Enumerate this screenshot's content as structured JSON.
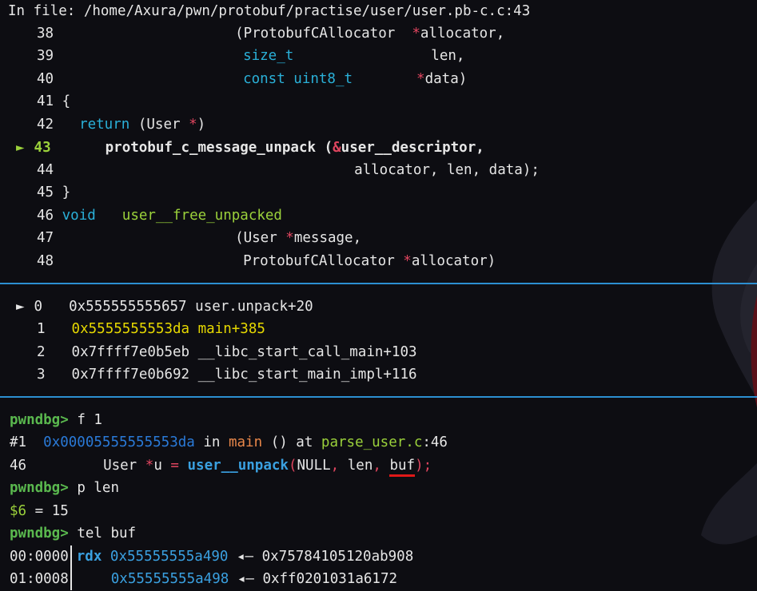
{
  "header": "In file: /home/Axura/pwn/protobuf/practise/user/user.pb-c.c:43",
  "source_lines": {
    "l38": {
      "num": "38",
      "a": "(ProtobufCAllocator  ",
      "star": "*",
      "b": "allocator,"
    },
    "l39": {
      "num": "39",
      "type": "size_t",
      "b": "len,"
    },
    "l40": {
      "num": "40",
      "type": "const uint8_t",
      "star": "*",
      "b": "data)"
    },
    "l41": {
      "num": "41",
      "b": "{"
    },
    "l42": {
      "num": "42",
      "kw": "return",
      "a": " (User ",
      "star": "*",
      "b": ")"
    },
    "l43": {
      "marker": "►",
      "num": "43",
      "fn": "protobuf_c_message_unpack",
      "a": " (",
      "amp": "&",
      "b": "user__descriptor,"
    },
    "l44": {
      "num": "44",
      "b": "allocator, len, data);"
    },
    "l45": {
      "num": "45",
      "b": "}"
    },
    "l46": {
      "num": "46",
      "kw": "void",
      "fn": "user__free_unpacked"
    },
    "l47": {
      "num": "47",
      "a": "(User ",
      "star": "*",
      "b": "message,"
    },
    "l48": {
      "num": "48",
      "a": "ProtobufCAllocator ",
      "star": "*",
      "b": "allocator)"
    }
  },
  "backtrace": [
    {
      "marker": "►",
      "idx": "0",
      "addr": "0x555555555657",
      "sym": "user.unpack+20"
    },
    {
      "idx": "1",
      "addr": "0x5555555553da",
      "sym": "main+385"
    },
    {
      "idx": "2",
      "addr": "0x7ffff7e0b5eb",
      "sym": "__libc_start_call_main+103"
    },
    {
      "idx": "3",
      "addr": "0x7ffff7e0b692",
      "sym": "__libc_start_main_impl+116"
    }
  ],
  "console": {
    "prompt": "pwndbg>",
    "cmd1": "f 1",
    "frame": {
      "id": "#1",
      "addr": "0x00005555555553da",
      "in": "in",
      "func": "main",
      "args": "() at",
      "file": "parse_user.c",
      "line": ":46"
    },
    "src46": {
      "num": "46",
      "type": "User",
      "star": "*",
      "var": "u",
      "eq": "=",
      "fn": "user__unpack",
      "lp": "(",
      "null": "NULL",
      "c1": ",",
      "len": "len",
      "c2": ",",
      "buf": "buf",
      "rp": ");"
    },
    "cmd2": "p len",
    "result": {
      "var": "$6",
      "eq": " = ",
      "val": "15"
    },
    "cmd3": "tel buf",
    "tel": [
      {
        "off": "00:0000",
        "reg": "rdx",
        "addr": "0x55555555a490",
        "arrow": "◂—",
        "val": "0x75784105120ab908"
      },
      {
        "off": "01:0008",
        "reg": "",
        "addr": "0x55555555a498",
        "arrow": "◂—",
        "val": "0xff0201031a6172"
      }
    ]
  }
}
